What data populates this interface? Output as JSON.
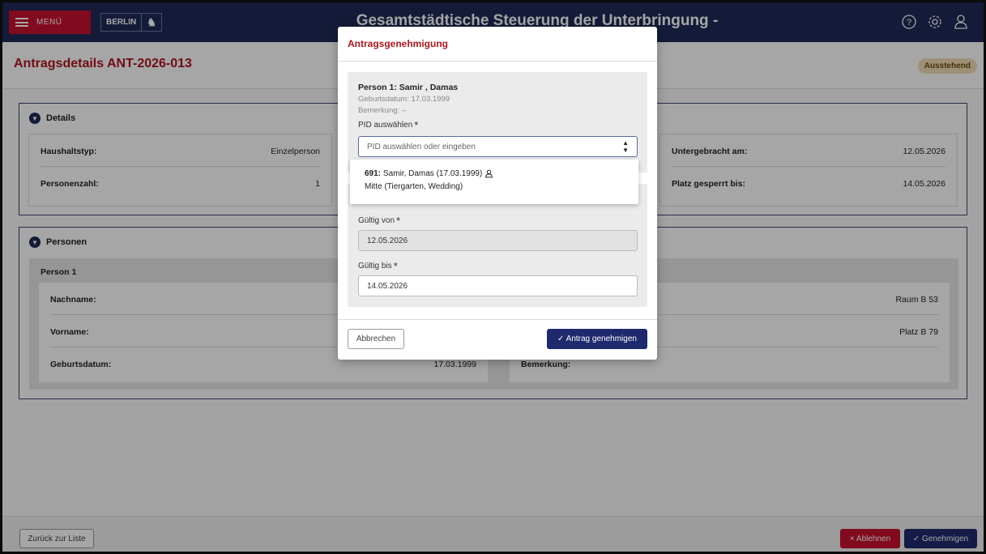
{
  "topbar": {
    "menu_label": "MENÜ",
    "logo_text": "BERLIN",
    "title": "Gesamtstädtische Steuerung der Unterbringung - INTRANET"
  },
  "page": {
    "title": "Antragsdetails ANT-2026-013",
    "status": "Ausstehend"
  },
  "details": {
    "heading": "Details",
    "left": [
      {
        "key": "Haushaltstyp:",
        "value": "Einzelperson"
      },
      {
        "key": "Personenzahl:",
        "value": "1"
      }
    ],
    "right": [
      {
        "key": "Untergebracht am:",
        "value": "12.05.2026"
      },
      {
        "key": "Platz gesperrt bis:",
        "value": "14.05.2026"
      }
    ]
  },
  "persons": {
    "heading": "Personen",
    "person_title": "Person 1",
    "left": [
      {
        "key": "Nachname:",
        "value": ""
      },
      {
        "key": "Vorname:",
        "value": ""
      },
      {
        "key": "Geburtsdatum:",
        "value": "17.03.1999"
      }
    ],
    "right": [
      {
        "key": "",
        "value": "Raum B 53"
      },
      {
        "key": "",
        "value": "Platz B 79"
      },
      {
        "key": "Bemerkung:",
        "value": ""
      }
    ]
  },
  "footer": {
    "back_label": "Zurück zur Liste",
    "reject_label": "× Ablehnen",
    "approve_label": "✓ Genehmigen"
  },
  "modal": {
    "title": "Antragsgenehmigung",
    "person_name": "Person 1: Samir , Damas",
    "birth": "Geburtsdatum: 17.03.1999",
    "remark": "Bemerkung: –",
    "pid_label": "PID auswählen",
    "pid_placeholder": "PID auswählen oder eingeben",
    "dropdown": {
      "option_id": "691:",
      "option_text": "Samir, Damas (17.03.1999)",
      "option_location": "Mitte (Tiergarten, Wedding)"
    },
    "valid_from_label": "Gültig von",
    "valid_from": "12.05.2026",
    "valid_to_label": "Gültig bis",
    "valid_to": "14.05.2026",
    "cancel_label": "Abbrechen",
    "confirm_label": "✓ Antrag genehmigen"
  }
}
